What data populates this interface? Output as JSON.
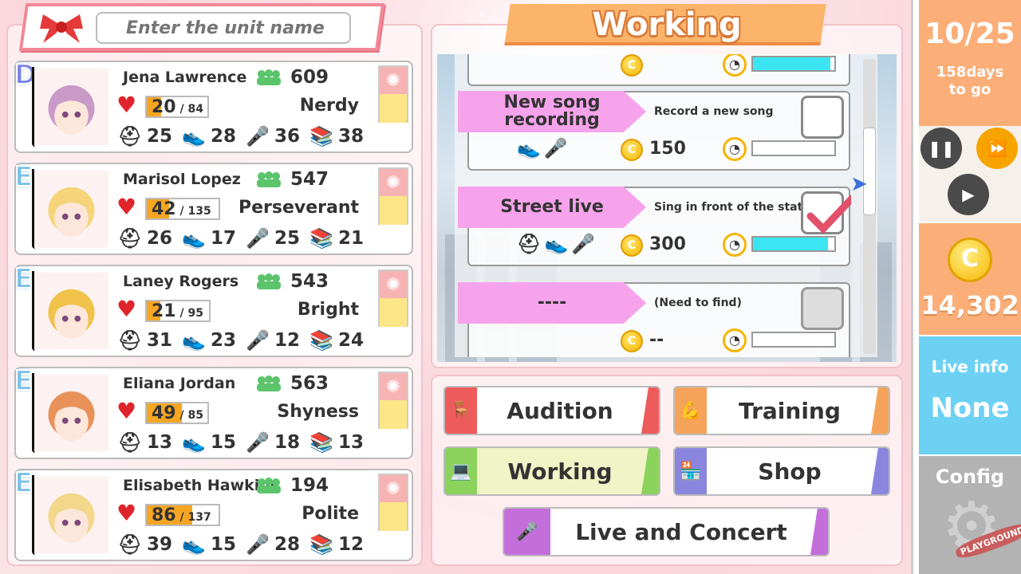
{
  "search": {
    "placeholder": "Enter the unit name"
  },
  "units": [
    {
      "rank": "D",
      "name": "Jena Lawrence",
      "fans": "609",
      "hp": "20",
      "hp_max": "84",
      "hp_frac": 0.24,
      "trait": "Nerdy",
      "stats": [
        "25",
        "28",
        "36",
        "38"
      ]
    },
    {
      "rank": "E",
      "name": "Marisol Lopez",
      "fans": "547",
      "hp": "42",
      "hp_max": "135",
      "hp_frac": 0.31,
      "trait": "Perseverant",
      "stats": [
        "26",
        "17",
        "25",
        "21"
      ]
    },
    {
      "rank": "E",
      "name": "Laney Rogers",
      "fans": "543",
      "hp": "21",
      "hp_max": "95",
      "hp_frac": 0.22,
      "trait": "Bright",
      "stats": [
        "31",
        "23",
        "12",
        "24"
      ]
    },
    {
      "rank": "E",
      "name": "Eliana Jordan",
      "fans": "563",
      "hp": "49",
      "hp_max": "85",
      "hp_frac": 0.58,
      "trait": "Shyness",
      "stats": [
        "13",
        "15",
        "18",
        "13"
      ]
    },
    {
      "rank": "E",
      "name": "Elisabeth Hawkins",
      "fans": "194",
      "hp": "86",
      "hp_max": "137",
      "hp_frac": 0.63,
      "trait": "Polite",
      "stats": [
        "39",
        "15",
        "28",
        "12"
      ]
    }
  ],
  "work": {
    "title": "Working",
    "jobs": [
      {
        "name": "New song recording",
        "desc": "Record a new song",
        "pay": "150",
        "progress": 0,
        "checked": false
      },
      {
        "name": "Street live",
        "desc": "Sing in front of the station",
        "pay": "300",
        "progress": 0.92,
        "checked": true
      },
      {
        "name": "----",
        "desc": "(Need to find)",
        "pay": "--",
        "progress": 0,
        "checked": false
      }
    ]
  },
  "menu": {
    "audition": "Audition",
    "training": "Training",
    "working": "Working",
    "shop": "Shop",
    "live": "Live and Concert"
  },
  "status": {
    "date": "10/25",
    "days_line1": "158days",
    "days_line2": "to go",
    "money": "14,302",
    "live_info_label": "Live info",
    "live_info_value": "None",
    "config_label": "Config",
    "watermark": "PLAYGROUND"
  },
  "colors": {
    "audition": "#ee5b5b",
    "training": "#f5a35a",
    "working": "#8bd35c",
    "shop": "#8a86de",
    "live": "#c46edb",
    "job_tag": "#f7a3ec",
    "progress": "#3be6f2"
  }
}
